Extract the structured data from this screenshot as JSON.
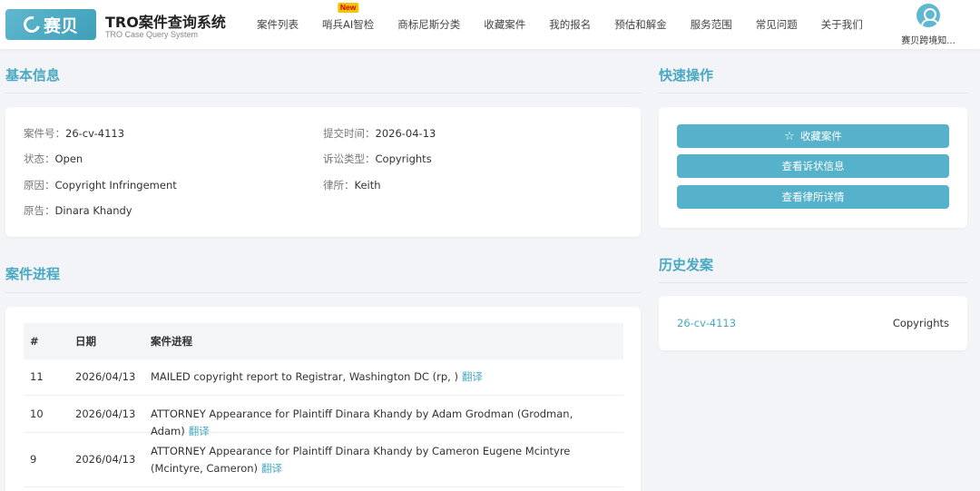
{
  "header": {
    "logo_text": "赛贝",
    "title": "TRO案件查询系统",
    "subtitle": "TRO Case Query System",
    "nav": [
      {
        "label": "案件列表"
      },
      {
        "label": "哨兵AI智检",
        "badge": "New"
      },
      {
        "label": "商标尼斯分类"
      },
      {
        "label": "收藏案件"
      },
      {
        "label": "我的报名"
      },
      {
        "label": "预估和解金"
      },
      {
        "label": "服务范围"
      },
      {
        "label": "常见问题"
      },
      {
        "label": "关于我们"
      }
    ],
    "user_name": "赛贝跨境知..."
  },
  "basic_info": {
    "title": "基本信息",
    "case_no_label": "案件号：",
    "case_no": "26-cv-4113",
    "submit_time_label": "提交时间：",
    "submit_time": "2026-04-13",
    "status_label": "状态：",
    "status": "Open",
    "suit_type_label": "诉讼类型：",
    "suit_type": "Copyrights",
    "cause_label": "原因：",
    "cause": "Copyright Infringement",
    "law_firm_label": "律所：",
    "law_firm": "Keith",
    "plaintiff_label": "原告：",
    "plaintiff": "Dinara Khandy"
  },
  "quick_actions": {
    "title": "快速操作",
    "favorite": "收藏案件",
    "view_complaint": "查看诉状信息",
    "view_law_firm": "查看律所详情"
  },
  "history": {
    "title": "历史发案",
    "items": [
      {
        "case_no": "26-cv-4113",
        "type": "Copyrights"
      }
    ]
  },
  "progress": {
    "title": "案件进程",
    "columns": [
      "#",
      "日期",
      "案件进程"
    ],
    "translate_label": "翻译",
    "rows": [
      {
        "num": "11",
        "date": "2026/04/13",
        "desc": "MAILED copyright report to Registrar, Washington DC (rp, )"
      },
      {
        "num": "10",
        "date": "2026/04/13",
        "desc": "ATTORNEY Appearance for Plaintiff Dinara Khandy by Adam Grodman (Grodman, Adam)"
      },
      {
        "num": "9",
        "date": "2026/04/13",
        "desc": "ATTORNEY Appearance for Plaintiff Dinara Khandy by Cameron Eugene Mcintyre (Mcintyre, Cameron)"
      }
    ]
  }
}
